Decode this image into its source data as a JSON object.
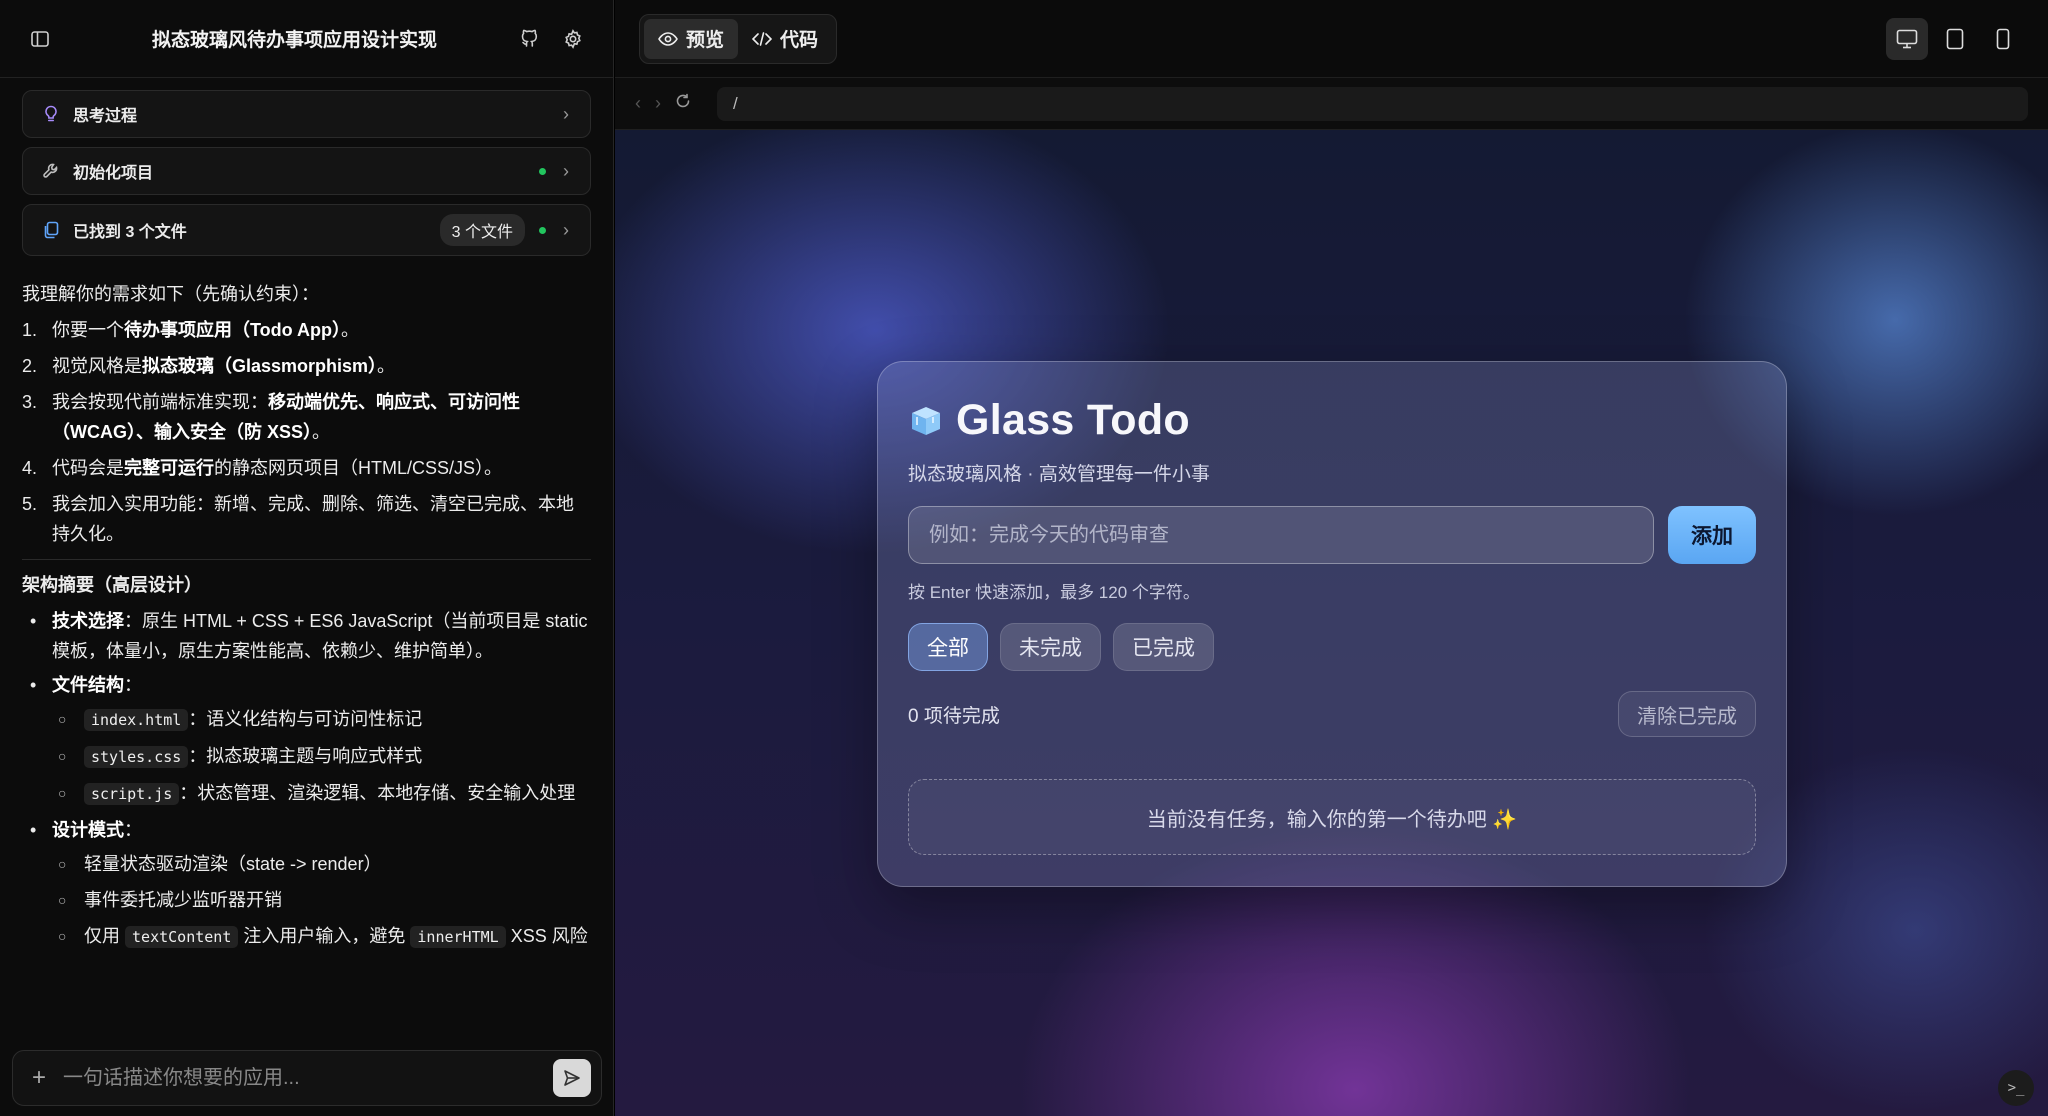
{
  "sidebar": {
    "title": "拟态玻璃风待办事项应用设计实现",
    "cards": [
      {
        "label": "思考过程"
      },
      {
        "label": "初始化项目"
      },
      {
        "label": "已找到 3 个文件",
        "badge": "3 个文件"
      }
    ]
  },
  "message": {
    "intro": "我理解你的需求如下（先确认约束）：",
    "req1_pre": "你要一个",
    "req1_bold": "待办事项应用（Todo App）",
    "req1_post": "。",
    "req2_pre": "视觉风格是",
    "req2_bold": "拟态玻璃（Glassmorphism）",
    "req2_post": "。",
    "req3_pre": "我会按现代前端标准实现：",
    "req3_bold": "移动端优先、响应式、可访问性（WCAG）、输入安全（防 XSS）",
    "req3_post": "。",
    "req4_pre": "代码会是",
    "req4_bold": "完整可运行",
    "req4_post": "的静态网页项目（HTML/CSS/JS）。",
    "req5": "我会加入实用功能：新增、完成、删除、筛选、清空已完成、本地持久化。",
    "arch_title": "架构摘要（高层设计）",
    "tech_label": "技术选择",
    "tech_text": "：原生 HTML + CSS + ES6 JavaScript（当前项目是 static 模板，体量小，原生方案性能高、依赖少、维护简单）。",
    "files_label": "文件结构",
    "files_colon": "：",
    "file1": "index.html",
    "file1_desc": "：语义化结构与可访问性标记",
    "file2": "styles.css",
    "file2_desc": "：拟态玻璃主题与响应式样式",
    "file3": "script.js",
    "file3_desc": "：状态管理、渲染逻辑、本地存储、安全输入处理",
    "design_label": "设计模式",
    "design_colon": "：",
    "dp1": "轻量状态驱动渲染（state -> render）",
    "dp2": "事件委托减少监听器开销",
    "dp3_pre": "仅用",
    "dp3_code1": "textContent",
    "dp3_mid": "注入用户输入，避免",
    "dp3_code2": "innerHTML",
    "dp3_post": "XSS 风险"
  },
  "composer": {
    "placeholder": "一句话描述你想要的应用..."
  },
  "topbar": {
    "tab_preview": "预览",
    "tab_code": "代码"
  },
  "address": {
    "url": "/"
  },
  "app": {
    "title": "Glass Todo",
    "subtitle": "拟态玻璃风格 · 高效管理每一件小事",
    "input_placeholder": "例如：完成今天的代码审查",
    "add_label": "添加",
    "hint": "按 Enter 快速添加，最多 120 个字符。",
    "filters": [
      "全部",
      "未完成",
      "已完成"
    ],
    "count_text": "0 项待完成",
    "clear_label": "清除已完成",
    "empty_text": "当前没有任务，输入你的第一个待办吧 ✨"
  },
  "icons": {
    "sidebar_toggle": "sidebar-toggle-icon",
    "github": "github-icon",
    "settings": "gear-icon",
    "thinking": "lightbulb-icon",
    "init": "wrench-icon",
    "files": "files-icon",
    "eye": "eye-icon",
    "code": "code-icon",
    "desktop": "desktop-icon",
    "tablet": "tablet-icon",
    "mobile": "mobile-icon",
    "cube": "ice-cube-icon",
    "send": "send-icon",
    "terminal": "terminal-icon"
  },
  "colors": {
    "accent_blue": "#6ab4fb",
    "status_green": "#22c55e",
    "thinking_purple": "#a78bfa",
    "files_blue": "#60a5fa"
  }
}
